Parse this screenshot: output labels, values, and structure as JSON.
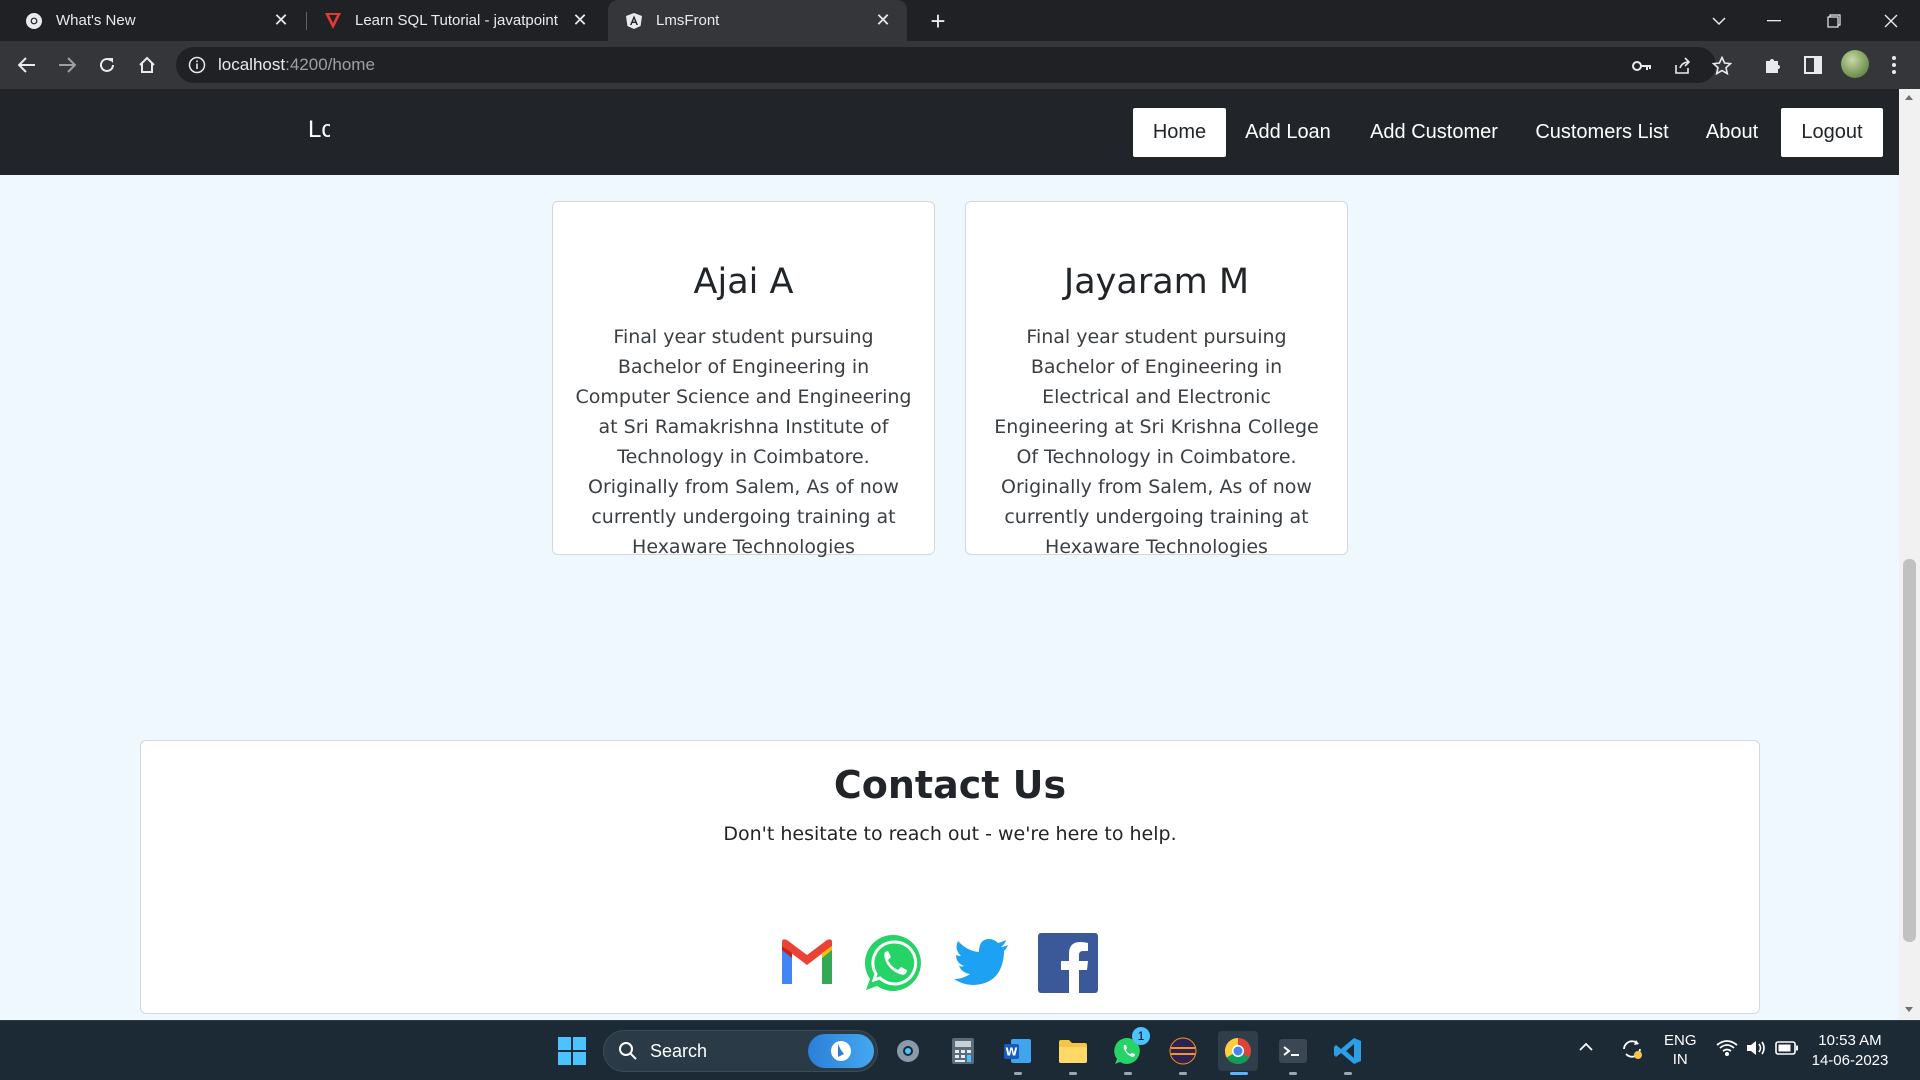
{
  "browser": {
    "tabs": [
      {
        "title": "What's New",
        "icon": "chrome-icon"
      },
      {
        "title": "Learn SQL Tutorial - javatpoint",
        "icon": "javatpoint-icon"
      },
      {
        "title": "LmsFront",
        "icon": "angular-icon",
        "active": true
      }
    ],
    "url_host": "localhost",
    "url_path": ":4200/home"
  },
  "app": {
    "brand": "Lc",
    "nav": {
      "home": "Home",
      "add_loan": "Add Loan",
      "add_customer": "Add Customer",
      "customers_list": "Customers List",
      "about": "About",
      "logout": "Logout"
    }
  },
  "team": [
    {
      "name": "Ajai A",
      "bio": "Final year student pursuing Bachelor of Engineering in Computer Science and Engineering at Sri Ramakrishna Institute of Technology in Coimbatore. Originally from Salem, As of now currently undergoing training at Hexaware Technologies"
    },
    {
      "name": "Jayaram M",
      "bio": "Final year student pursuing Bachelor of Engineering in Electrical and Electronic Engineering at Sri Krishna College Of Technology in Coimbatore. Originally from Salem, As of now currently undergoing training at Hexaware Technologies"
    }
  ],
  "contact": {
    "title": "Contact Us",
    "subtitle": "Don't hesitate to reach out - we're here to help.",
    "socials": [
      "gmail-icon",
      "whatsapp-icon",
      "twitter-icon",
      "facebook-icon"
    ]
  },
  "taskbar": {
    "search_label": "Search",
    "whatsapp_badge": "1",
    "lang_top": "ENG",
    "lang_bottom": "IN",
    "time": "10:53 AM",
    "date": "14-06-2023"
  },
  "colors": {
    "page_bg": "#f0f8ff",
    "navbar_bg": "#212529",
    "chrome_dark": "#202124",
    "taskbar_bg": "#1c2a36"
  }
}
